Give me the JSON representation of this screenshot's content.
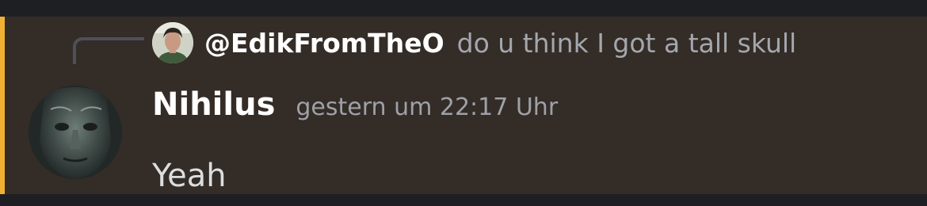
{
  "message": {
    "accent_color": "#f0b132",
    "background_color": "#342c27",
    "reply": {
      "author": "@EdikFromTheO",
      "preview": "do u think I got a tall skull",
      "avatar_icon": "user-photo-avatar"
    },
    "author": "Nihilus",
    "timestamp": "gestern um 22:17 Uhr",
    "content": "Yeah",
    "avatar_icon": "statue-face-avatar"
  }
}
